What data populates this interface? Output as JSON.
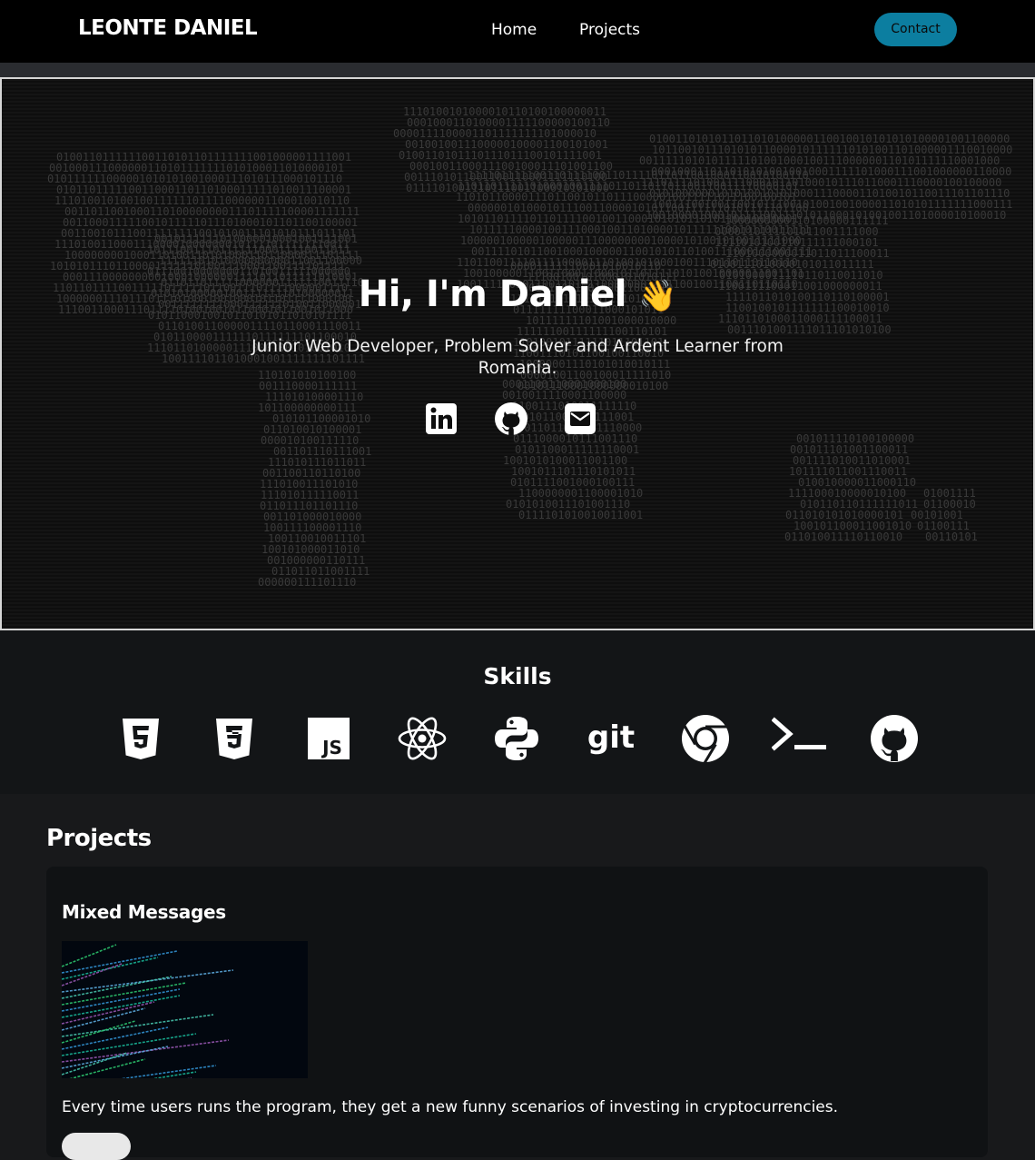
{
  "navbar": {
    "brand": "LEONTE DANIEL",
    "links": [
      {
        "label": "Home"
      },
      {
        "label": "Projects"
      }
    ],
    "contact_label": "Contact",
    "contact_color": "#0c7ea0"
  },
  "hero": {
    "title": "Hi, I'm Daniel",
    "emoji": "👋",
    "subtitle": "Junior Web Developer, Problem Solver and Ardent Learner from Romania.",
    "social_icons": [
      "linkedin-icon",
      "github-icon",
      "email-icon"
    ]
  },
  "skills": {
    "title": "Skills",
    "icons": [
      "html5-icon",
      "css3-icon",
      "javascript-icon",
      "react-icon",
      "python-icon",
      "git-icon",
      "chrome-icon",
      "terminal-icon",
      "github-icon"
    ],
    "git_text": "git",
    "js_text": "JS"
  },
  "projects": {
    "title": "Projects",
    "items": [
      {
        "name": "Mixed Messages",
        "description": "Every time users runs the program, they get a new funny scenarios of investing in cryptocurrencies."
      }
    ]
  }
}
